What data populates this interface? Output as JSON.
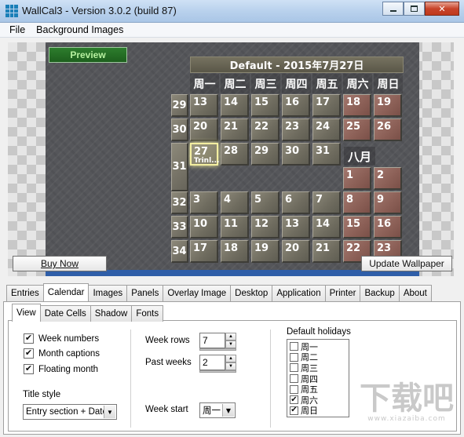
{
  "window": {
    "title": "WallCal3 - Version 3.0.2 (build 87)"
  },
  "menu": [
    "File",
    "Background Images"
  ],
  "preview": {
    "label": "Preview",
    "calendar_title": "Default - 2015年7月27日",
    "day_headers": [
      "周一",
      "周二",
      "周三",
      "周四",
      "周五",
      "周六",
      "周日"
    ],
    "week_numbers": [
      "29",
      "30",
      "31",
      "32",
      "33",
      "34"
    ],
    "july_rows": [
      [
        "13",
        "14",
        "15",
        "16",
        "17",
        "18",
        "19"
      ],
      [
        "20",
        "21",
        "22",
        "23",
        "24",
        "25",
        "26"
      ],
      [
        "27",
        "28",
        "29",
        "30",
        "31"
      ]
    ],
    "today_note": "Trinl...",
    "next_month": "八月",
    "august_rows": [
      [
        "1",
        "2"
      ],
      [
        "3",
        "4",
        "5",
        "6",
        "7",
        "8",
        "9"
      ],
      [
        "10",
        "11",
        "12",
        "13",
        "14",
        "15",
        "16"
      ],
      [
        "17",
        "18",
        "19",
        "20",
        "21",
        "22",
        "23"
      ]
    ],
    "buy_now": "Buy Now",
    "update_wallpaper": "Update Wallpaper"
  },
  "tabs": [
    "Entries",
    "Calendar",
    "Images",
    "Panels",
    "Overlay Image",
    "Desktop",
    "Application",
    "Printer",
    "Backup",
    "About"
  ],
  "subtabs": [
    "View",
    "Date Cells",
    "Shadow",
    "Fonts"
  ],
  "view": {
    "week_numbers_label": "Week numbers",
    "week_numbers_checked": true,
    "month_captions_label": "Month captions",
    "month_captions_checked": true,
    "floating_month_label": "Floating month",
    "floating_month_checked": true,
    "title_style_label": "Title style",
    "title_style_value": "Entry section + Date",
    "week_rows_label": "Week rows",
    "week_rows_value": "7",
    "past_weeks_label": "Past weeks",
    "past_weeks_value": "2",
    "week_start_label": "Week start",
    "week_start_value": "周一",
    "holidays_label": "Default holidays",
    "holidays": [
      {
        "label": "周一",
        "checked": false
      },
      {
        "label": "周二",
        "checked": false
      },
      {
        "label": "周三",
        "checked": false
      },
      {
        "label": "周四",
        "checked": false
      },
      {
        "label": "周五",
        "checked": false
      },
      {
        "label": "周六",
        "checked": true
      },
      {
        "label": "周日",
        "checked": true
      }
    ]
  },
  "watermark": {
    "main": "下载吧",
    "sub": "www.xiazaiba.com"
  }
}
